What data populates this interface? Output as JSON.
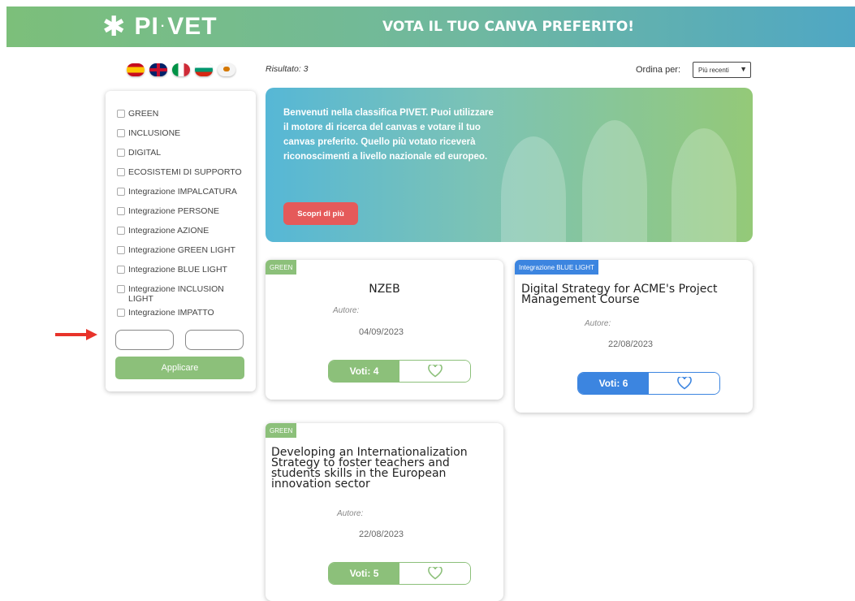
{
  "header": {
    "logo_pre": "PI",
    "logo_post": "VET",
    "title": "VOTA IL TUO CANVA PREFERITO!"
  },
  "languages": [
    "spanish-flag-icon",
    "uk-flag-icon",
    "italy-flag-icon",
    "bulgaria-flag-icon",
    "cyprus-flag-icon"
  ],
  "filters": [
    {
      "label": "GREEN"
    },
    {
      "label": "INCLUSIONE"
    },
    {
      "label": "DIGITAL"
    },
    {
      "label": "ECOSISTEMI DI SUPPORTO"
    },
    {
      "label": "Integrazione IMPALCATURA"
    },
    {
      "label": "Integrazione PERSONE"
    },
    {
      "label": "Integrazione AZIONE"
    },
    {
      "label": "Integrazione GREEN LIGHT"
    },
    {
      "label": "Integrazione BLUE LIGHT"
    },
    {
      "label": "Integrazione INCLUSION LIGHT"
    },
    {
      "label": "Integrazione IMPATTO"
    }
  ],
  "apply_label": "Applicare",
  "results_label": "Risultato: 3",
  "sort": {
    "label": "Ordina per:",
    "selected": "Più recenti"
  },
  "banner": {
    "text": "Benvenuti nella classifica PIVET. Puoi utilizzare il motore di ricerca del canvas e votare il tuo canvas preferito. Quello più votato riceverà riconoscimenti a livello nazionale ed europeo.",
    "button_label": "Scopri di più"
  },
  "cards": [
    {
      "tag": "GREEN",
      "title": "NZEB",
      "author": "Autore:",
      "date": "04/09/2023",
      "votes": "Voti: 4"
    },
    {
      "tag": "Integrazione BLUE LIGHT",
      "title": "Digital Strategy for ACME's Project Management Course",
      "author": "Autore:",
      "date": "22/08/2023",
      "votes": "Voti: 6"
    },
    {
      "tag": "GREEN",
      "title": "Developing an Internationalization Strategy to foster teachers and students skills in the European innovation sector",
      "author": "Autore:",
      "date": "22/08/2023",
      "votes": "Voti: 5"
    }
  ],
  "colors": {
    "green": "#8cc07a",
    "blue": "#3c85e0",
    "red_button": "#e55a5a",
    "arrow": "#e8332a"
  }
}
